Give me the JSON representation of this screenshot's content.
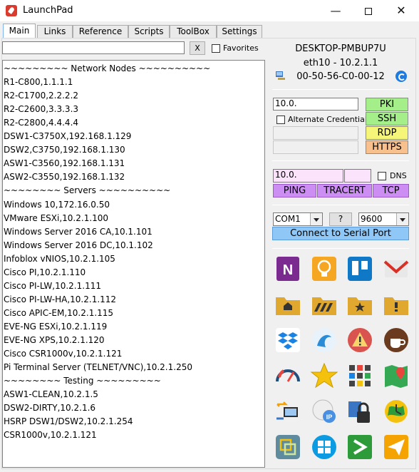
{
  "window": {
    "title": "LaunchPad",
    "minimize_glyph": "—",
    "close_glyph": "✕"
  },
  "tabs": [
    {
      "label": "Main",
      "active": true
    },
    {
      "label": "Links"
    },
    {
      "label": "Reference"
    },
    {
      "label": "Scripts"
    },
    {
      "label": "ToolBox"
    },
    {
      "label": "Settings"
    }
  ],
  "filter": {
    "value": "",
    "clear_label": "X",
    "favorites_label": "Favorites"
  },
  "nodes": [
    " ~~~~~~~~~ Network Nodes ~~~~~~~~~~",
    "R1-C800,1.1.1.1",
    "R2-C1700,2.2.2.2",
    "R2-C2600,3.3.3.3",
    "R2-C2800,4.4.4.4",
    "DSW1-C3750X,192.168.1.129",
    "DSW2,C3750,192.168.1.130",
    "ASW1-C3560,192.168.1.131",
    "ASW2-C3550,192.168.1.132",
    " ~~~~~~~~ Servers ~~~~~~~~~~",
    "Windows 10,172.16.0.50",
    "VMware ESXi,10.2.1.100",
    "Windows Server 2016 CA,10.1.101",
    "Windows Server 2016 DC,10.1.102",
    "Infoblox vNIOS,10.2.1.105",
    "Cisco PI,10.2.1.110",
    "Cisco PI-LW,10.2.1.111",
    "Cisco PI-LW-HA,10.2.1.112",
    "Cisco APIC-EM,10.2.1.115",
    "EVE-NG ESXi,10.2.1.119",
    "EVE-NG XPS,10.2.1.120",
    "Cisco CSR1000v,10.2.1.121",
    "Pi Terminal Server (TELNET/VNC),10.2.1.250",
    " ~~~~~~~~ Testing ~~~~~~~~~",
    "ASW1-CLEAN,10.2.1.5",
    "DSW2-DIRTY,10.2.1.6",
    "HSRP DSW1/DSW2,10.2.1.254",
    "CSR1000v,10.2.1.121"
  ],
  "host": {
    "name": "DESKTOP-PMBUP7U",
    "interface": "eth10 - 10.2.1.1",
    "mac": "00-50-56-C0-00-12"
  },
  "connect": {
    "address": "10.0.",
    "alt_credentials_label": "Alternate Credentials",
    "pki": "PKI",
    "ssh": "SSH",
    "rdp": "RDP",
    "https": "HTTPS"
  },
  "diag": {
    "address": "10.0.",
    "dns_label": "DNS",
    "ping": "PING",
    "tracert": "TRACERT",
    "tcp": "TCP"
  },
  "serial": {
    "port": "COM1",
    "help": "?",
    "baud": "9600",
    "connect": "Connect to Serial Port"
  },
  "apps": [
    {
      "name": "onenote-icon",
      "color": "#7b2b8f"
    },
    {
      "name": "lightbulb-icon",
      "color": "#f5a623"
    },
    {
      "name": "trello-icon",
      "color": "#0f78c7"
    },
    {
      "name": "gmail-icon",
      "color": "#e8e8e8"
    },
    {
      "name": "home-folder-icon",
      "color": "#e0a82e"
    },
    {
      "name": "striped-folder-icon",
      "color": "#e0a82e"
    },
    {
      "name": "favorites-folder-icon",
      "color": "#e0a82e"
    },
    {
      "name": "alert-folder-icon",
      "color": "#e0a82e"
    },
    {
      "name": "dropbox-icon",
      "color": "#ffffff"
    },
    {
      "name": "wireshark-icon",
      "color": "#2a8bd6"
    },
    {
      "name": "warning-icon",
      "color": "#d9534f"
    },
    {
      "name": "java-icon",
      "color": "#6b3b1f"
    },
    {
      "name": "speedometer-icon",
      "color": "#1f4f7a"
    },
    {
      "name": "star-icon",
      "color": "#f4c20d"
    },
    {
      "name": "grid-apps-icon",
      "color": "#444444"
    },
    {
      "name": "maps-icon",
      "color": "#34a853"
    },
    {
      "name": "network-transfer-icon",
      "color": "#3a76c4"
    },
    {
      "name": "ip-globe-icon",
      "color": "#4a90e2"
    },
    {
      "name": "lock-icon",
      "color": "#2f2f2f"
    },
    {
      "name": "clock-globe-icon",
      "color": "#2e9b3a"
    },
    {
      "name": "vmware-icon",
      "color": "#5f8b9f"
    },
    {
      "name": "windows-icon",
      "color": "#0a9be3"
    },
    {
      "name": "terminal-icon",
      "color": "#2e9b3a"
    },
    {
      "name": "paper-plane-icon",
      "color": "#f5a300"
    }
  ]
}
